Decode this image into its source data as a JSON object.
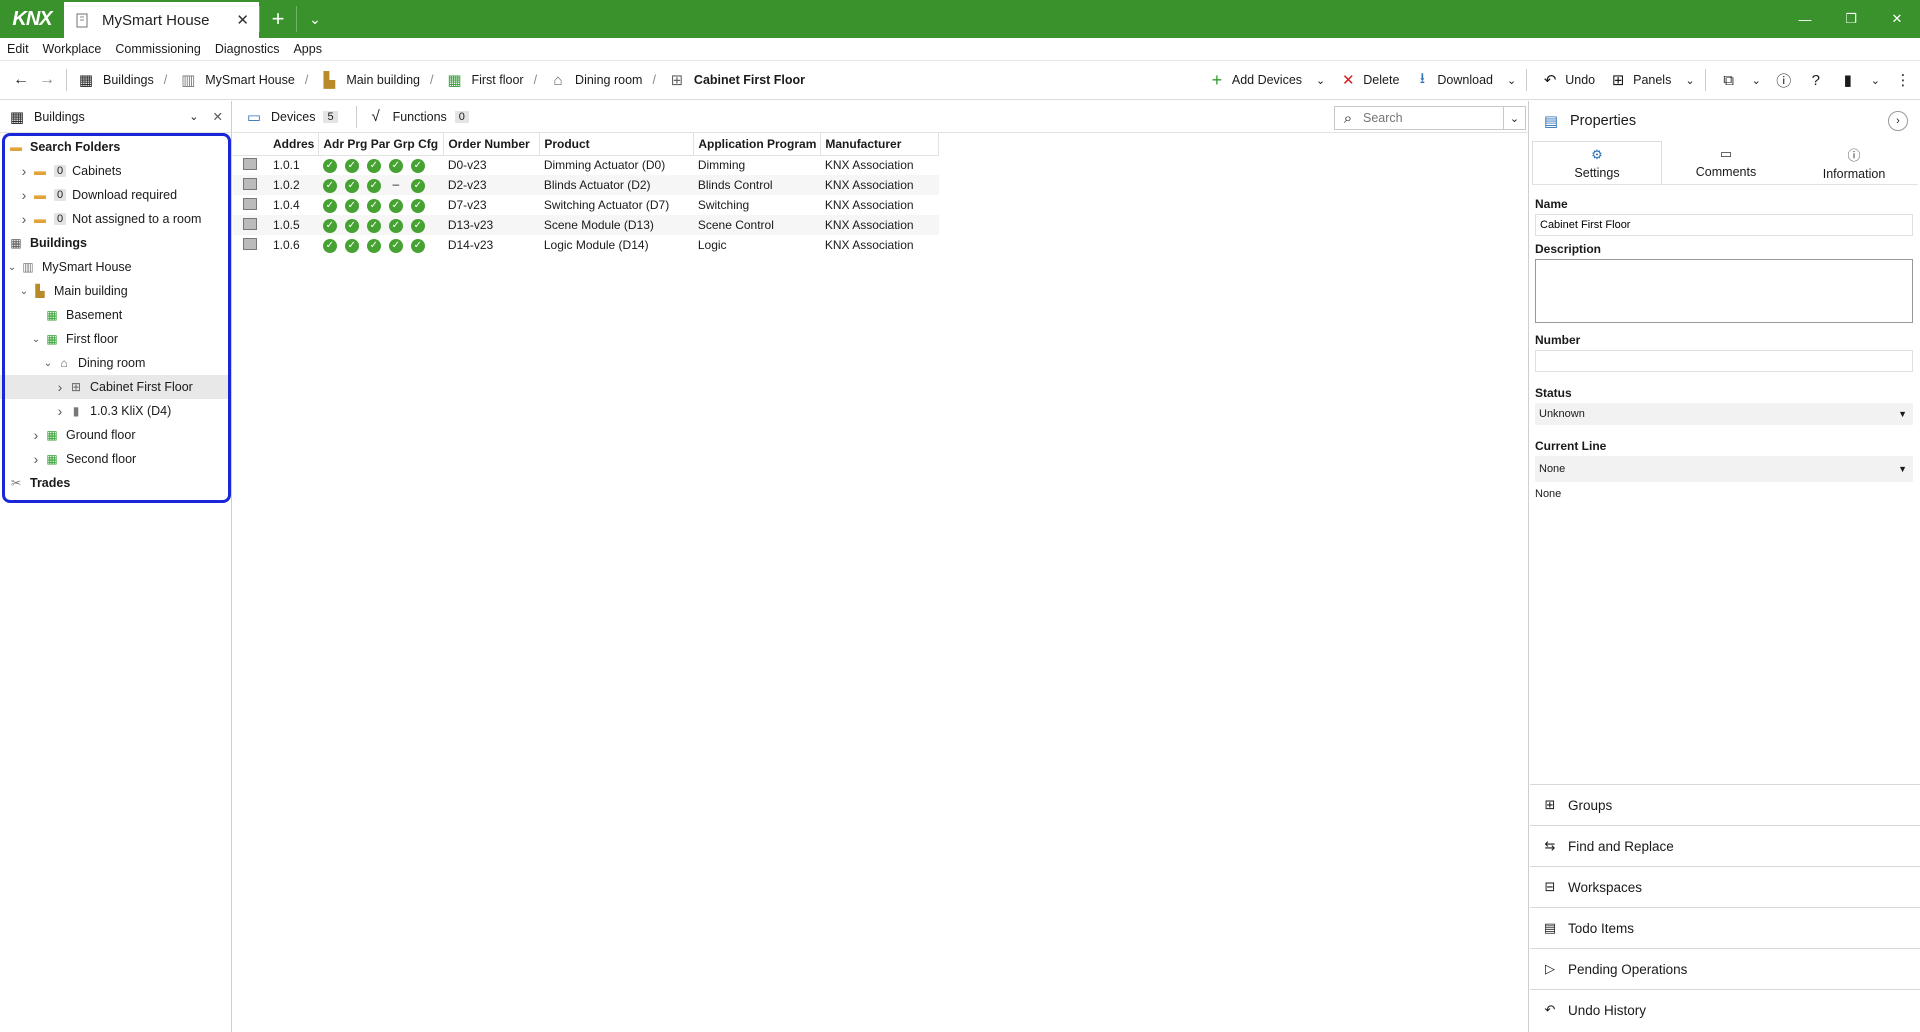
{
  "app": {
    "logo": "KNX",
    "doc_tab_title": "MySmart House",
    "colors": {
      "titlebar": "#3a922c",
      "accent_green": "#46a232",
      "highlight_box": "#1a27d8"
    }
  },
  "menu": [
    "Edit",
    "Workplace",
    "Commissioning",
    "Diagnostics",
    "Apps"
  ],
  "breadcrumb": [
    "Buildings",
    "MySmart House",
    "Main building",
    "First floor",
    "Dining room",
    "Cabinet First Floor"
  ],
  "toolbar": {
    "add_devices": "Add Devices",
    "delete": "Delete",
    "download": "Download",
    "undo": "Undo",
    "panels": "Panels"
  },
  "left_panel": {
    "title": "Buildings",
    "tree": [
      {
        "label": "Search Folders",
        "level": 0,
        "twisty": "",
        "icon": "folder-icon",
        "bold": true
      },
      {
        "label": "Cabinets",
        "level": 1,
        "twisty": ">",
        "icon": "folder-icon",
        "badge": "0"
      },
      {
        "label": "Download required",
        "level": 1,
        "twisty": ">",
        "icon": "folder-icon",
        "badge": "0"
      },
      {
        "label": "Not assigned to a room",
        "level": 1,
        "twisty": ">",
        "icon": "folder-icon",
        "badge": "0"
      },
      {
        "label": "Buildings",
        "level": 0,
        "twisty": "",
        "icon": "buildings-icon",
        "bold": true
      },
      {
        "label": "MySmart House",
        "level": 0,
        "twisty": "v",
        "icon": "house-icon"
      },
      {
        "label": "Main building",
        "level": 1,
        "twisty": "v",
        "icon": "building-icon"
      },
      {
        "label": "Basement",
        "level": 2,
        "twisty": "",
        "icon": "floor-icon"
      },
      {
        "label": "First floor",
        "level": 2,
        "twisty": "v",
        "icon": "floor-icon"
      },
      {
        "label": "Dining room",
        "level": 3,
        "twisty": "v",
        "icon": "room-icon"
      },
      {
        "label": "Cabinet First Floor",
        "level": 4,
        "twisty": ">",
        "icon": "cabinet-icon",
        "selected": true
      },
      {
        "label": "1.0.3 KliX (D4)",
        "level": 4,
        "twisty": ">",
        "icon": "device-icon"
      },
      {
        "label": "Ground floor",
        "level": 2,
        "twisty": ">",
        "icon": "floor-icon"
      },
      {
        "label": "Second floor",
        "level": 2,
        "twisty": ">",
        "icon": "floor-icon"
      },
      {
        "label": "Trades",
        "level": 0,
        "twisty": "",
        "icon": "trades-icon",
        "bold": true
      }
    ]
  },
  "center": {
    "tabs": [
      {
        "label": "Devices",
        "count": "5"
      },
      {
        "label": "Functions",
        "count": "0"
      }
    ],
    "search_placeholder": "Search",
    "columns": [
      "Addres",
      "Adr",
      "Prg",
      "Par",
      "Grp",
      "Cfg",
      "Order Number",
      "Product",
      "Application Program",
      "Manufacturer"
    ],
    "rows": [
      {
        "address": "1.0.1",
        "status": [
          "ok",
          "ok",
          "ok",
          "ok",
          "ok"
        ],
        "order": "D0-v23",
        "product": "Dimming Actuator (D0)",
        "app": "Dimming",
        "manufacturer": "KNX Association"
      },
      {
        "address": "1.0.2",
        "status": [
          "ok",
          "ok",
          "ok",
          "none",
          "ok"
        ],
        "order": "D2-v23",
        "product": "Blinds Actuator (D2)",
        "app": "Blinds Control",
        "manufacturer": "KNX Association"
      },
      {
        "address": "1.0.4",
        "status": [
          "ok",
          "ok",
          "ok",
          "ok",
          "ok"
        ],
        "order": "D7-v23",
        "product": "Switching Actuator (D7)",
        "app": "Switching",
        "manufacturer": "KNX Association"
      },
      {
        "address": "1.0.5",
        "status": [
          "ok",
          "ok",
          "ok",
          "ok",
          "ok"
        ],
        "order": "D13-v23",
        "product": "Scene Module (D13)",
        "app": "Scene Control",
        "manufacturer": "KNX Association"
      },
      {
        "address": "1.0.6",
        "status": [
          "ok",
          "ok",
          "ok",
          "ok",
          "ok"
        ],
        "order": "D14-v23",
        "product": "Logic Module (D14)",
        "app": "Logic",
        "manufacturer": "KNX Association"
      }
    ]
  },
  "properties": {
    "title": "Properties",
    "tabs": [
      "Settings",
      "Comments",
      "Information"
    ],
    "name_label": "Name",
    "name_value": "Cabinet First Floor",
    "description_label": "Description",
    "number_label": "Number",
    "status_label": "Status",
    "status_value": "Unknown",
    "current_line_label": "Current Line",
    "current_line_value": "None",
    "current_line_text": "None"
  },
  "side_panels": [
    "Groups",
    "Find and Replace",
    "Workspaces",
    "Todo Items",
    "Pending Operations",
    "Undo History"
  ]
}
